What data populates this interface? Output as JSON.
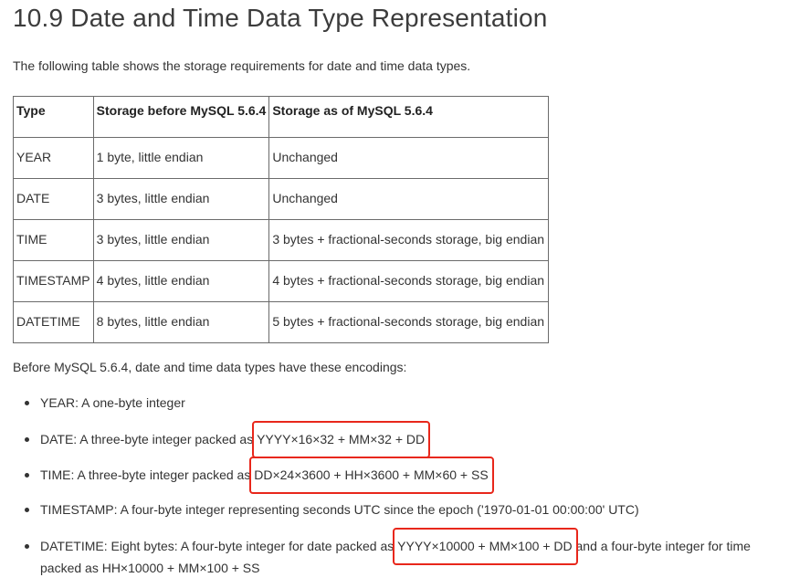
{
  "title": "10.9 Date and Time Data Type Representation",
  "intro": "The following table shows the storage requirements for date and time data types.",
  "table": {
    "headers": [
      "Type",
      "Storage before MySQL 5.6.4",
      "Storage as of MySQL 5.6.4"
    ],
    "rows": [
      [
        "YEAR",
        "1 byte, little endian",
        "Unchanged"
      ],
      [
        "DATE",
        "3 bytes, little endian",
        "Unchanged"
      ],
      [
        "TIME",
        "3 bytes, little endian",
        "3 bytes + fractional-seconds storage, big endian"
      ],
      [
        "TIMESTAMP",
        "4 bytes, little endian",
        "4 bytes + fractional-seconds storage, big endian"
      ],
      [
        "DATETIME",
        "8 bytes, little endian",
        "5 bytes + fractional-seconds storage, big endian"
      ]
    ]
  },
  "before_text": "Before MySQL 5.6.4, date and time data types have these encodings:",
  "encodings": {
    "year": "YEAR: A one-byte integer",
    "date_prefix": "DATE: A three-byte integer packed as",
    "date_formula": "YYYY×16×32 + MM×32 + DD",
    "time_prefix": "TIME: A three-byte integer packed as",
    "time_formula": "DD×24×3600 + HH×3600 + MM×60 + SS",
    "timestamp": "TIMESTAMP: A four-byte integer representing seconds UTC since the epoch ('1970-01-01 00:00:00' UTC)",
    "datetime_prefix": "DATETIME: Eight bytes: A four-byte integer for date packed as",
    "datetime_formula": "YYYY×10000 + MM×100 + DD",
    "datetime_suffix": "and a four-byte integer for time",
    "datetime_line2": "packed as HH×10000 + MM×100 + SS"
  },
  "highlight_color": "#e8271b"
}
